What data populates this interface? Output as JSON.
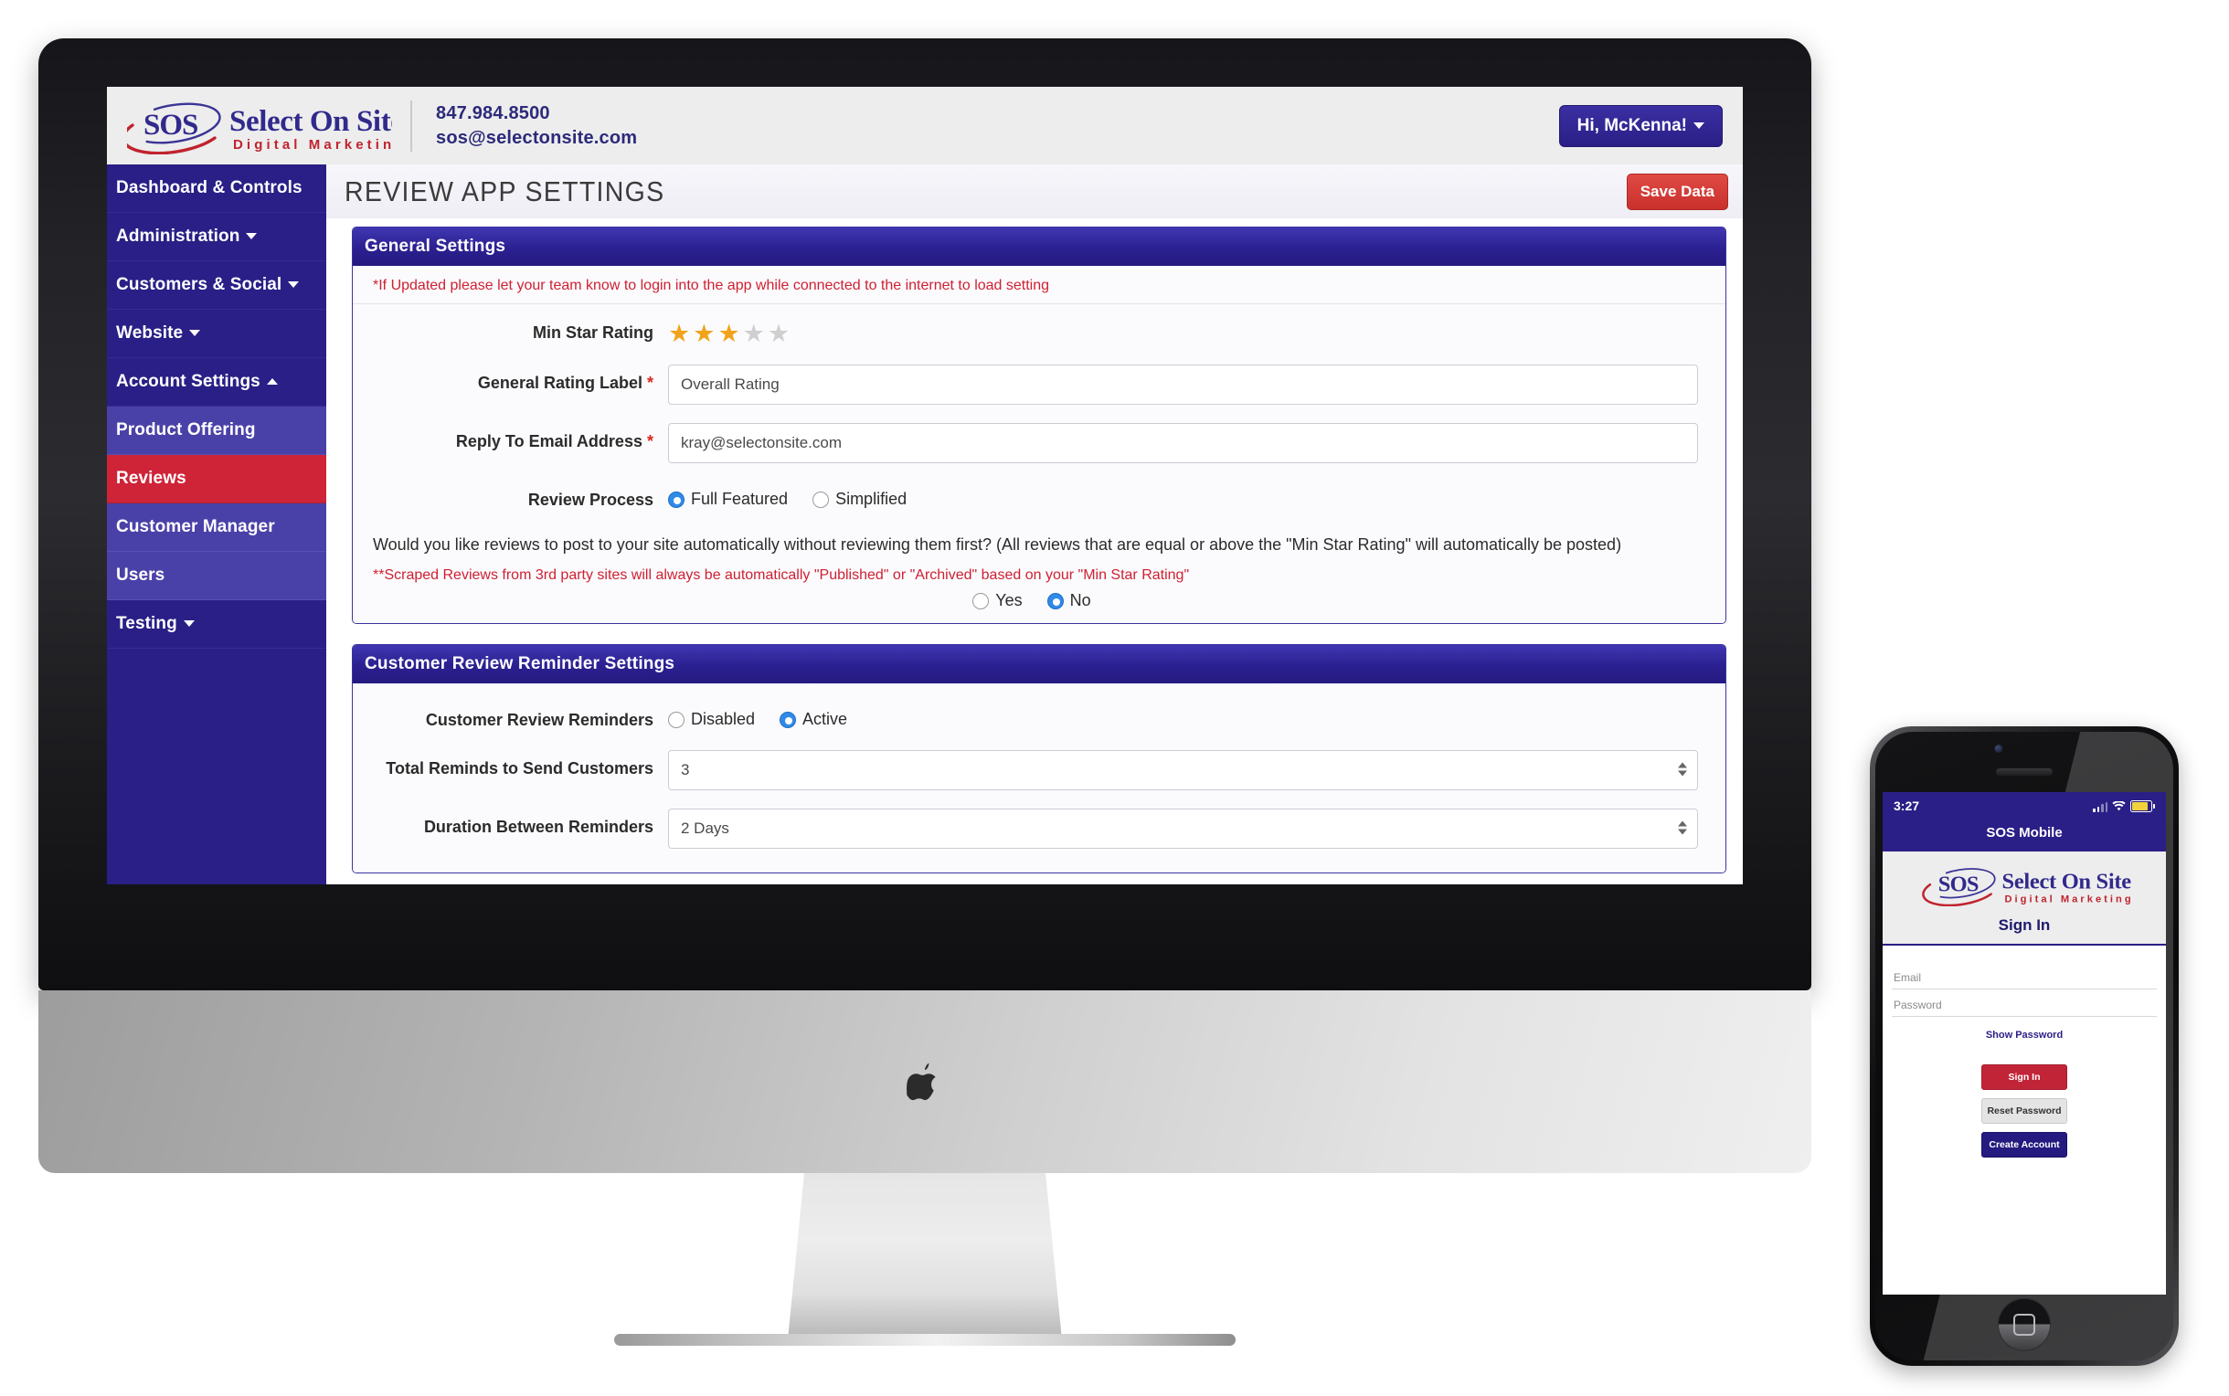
{
  "brand": {
    "mark": "SOS",
    "name": "Select On Site",
    "tagline": "Digital Marketing"
  },
  "header": {
    "phone": "847.984.8500",
    "email": "sos@selectonsite.com",
    "user_button": "Hi, McKenna!"
  },
  "sidebar": {
    "items": [
      {
        "label": "Dashboard & Controls",
        "type": "top",
        "caret": "none",
        "state": "normal"
      },
      {
        "label": "Administration",
        "type": "top",
        "caret": "down",
        "state": "normal"
      },
      {
        "label": "Customers & Social",
        "type": "top",
        "caret": "down",
        "state": "normal"
      },
      {
        "label": "Website",
        "type": "top",
        "caret": "down",
        "state": "normal"
      },
      {
        "label": "Account Settings",
        "type": "top",
        "caret": "up",
        "state": "normal"
      },
      {
        "label": "Product Offering",
        "type": "sub",
        "caret": "none",
        "state": "normal"
      },
      {
        "label": "Reviews",
        "type": "sub",
        "caret": "none",
        "state": "active"
      },
      {
        "label": "Customer Manager",
        "type": "sub",
        "caret": "none",
        "state": "normal"
      },
      {
        "label": "Users",
        "type": "sub",
        "caret": "none",
        "state": "normal"
      },
      {
        "label": "Testing",
        "type": "top",
        "caret": "down",
        "state": "normal"
      }
    ]
  },
  "page": {
    "title": "REVIEW APP SETTINGS",
    "save_label": "Save Data"
  },
  "general_settings": {
    "panel_title": "General Settings",
    "warning": "*If Updated please let your team know to login into the app while connected to the internet to load setting",
    "min_star_rating_label": "Min Star Rating",
    "min_star_rating_value": 3,
    "max_stars": 5,
    "general_rating_label": "General Rating Label",
    "general_rating_value": "Overall Rating",
    "reply_email_label": "Reply To Email Address",
    "reply_email_value": "kray@selectonsite.com",
    "review_process_label": "Review Process",
    "review_process_options": [
      "Full Featured",
      "Simplified"
    ],
    "review_process_selected": "Full Featured",
    "auto_post_question": "Would you like reviews to post to your site automatically without reviewing them first? (All reviews that are equal or above the \"Min Star Rating\" will automatically be posted)",
    "auto_post_note": "**Scraped Reviews from 3rd party sites will always be automatically \"Published\" or \"Archived\" based on your \"Min Star Rating\"",
    "auto_post_options": [
      "Yes",
      "No"
    ],
    "auto_post_selected": "No"
  },
  "reminder_settings": {
    "panel_title": "Customer Review Reminder Settings",
    "reminders_label": "Customer Review Reminders",
    "reminders_options": [
      "Disabled",
      "Active"
    ],
    "reminders_selected": "Active",
    "total_reminds_label": "Total Reminds to Send Customers",
    "total_reminds_value": "3",
    "duration_label": "Duration Between Reminders",
    "duration_value": "2 Days"
  },
  "phone": {
    "status_time": "3:27",
    "app_title": "SOS Mobile",
    "screen_title": "Sign In",
    "email_placeholder": "Email",
    "password_placeholder": "Password",
    "show_password": "Show Password",
    "signin_button": "Sign In",
    "reset_button": "Reset Password",
    "create_button": "Create Account"
  },
  "colors": {
    "sidebar": "#291f86",
    "sidebar_sub": "#4a41a8",
    "active_red": "#cf2438",
    "panel_header": "#2b2090",
    "brand_purple": "#2c2a7a",
    "brand_red": "#c0232e",
    "star_on": "#f0a31b",
    "star_off": "#cfcfcf",
    "radio_checked": "#2f8ae8"
  }
}
